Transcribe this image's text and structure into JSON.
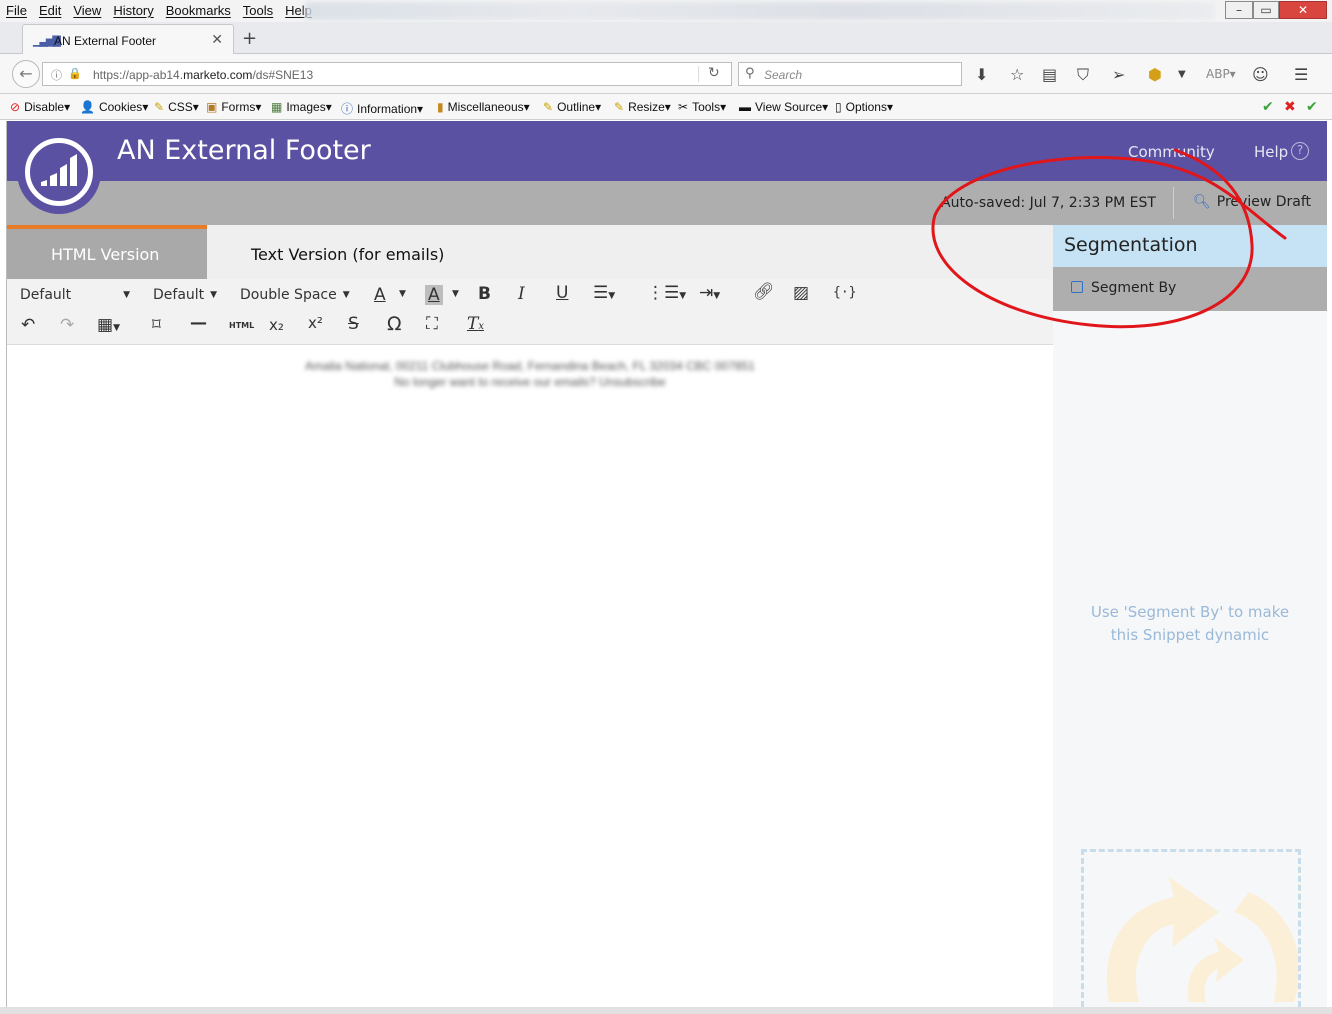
{
  "menubar": {
    "items": [
      "File",
      "Edit",
      "View",
      "History",
      "Bookmarks",
      "Tools",
      "Help"
    ]
  },
  "browser": {
    "tab_title": "AN External Footer",
    "url_prefix": "https://app-ab14.",
    "url_host": "marketo.com",
    "url_path": "/ds#SNE13",
    "search_placeholder": "Search"
  },
  "devbar": {
    "items": [
      "Disable",
      "Cookies",
      "CSS",
      "Forms",
      "Images",
      "Information",
      "Miscellaneous",
      "Outline",
      "Resize",
      "Tools",
      "View Source",
      "Options"
    ]
  },
  "app": {
    "title": "AN External Footer",
    "community": "Community",
    "help": "Help",
    "autosaved": "Auto-saved: Jul 7, 2:33 PM EST",
    "preview": "Preview Draft"
  },
  "editor": {
    "tab_html": "HTML Version",
    "tab_text": "Text Version (for emails)",
    "font_select": "Default",
    "size_select": "Default",
    "spacing_select": "Double Space",
    "blur_line1": "Amalia National, 00211 Clubhouse Road, Fernandina Beach, FL 32034 CBC 007851",
    "blur_line2": "No longer want to receive our emails? Unsubscribe"
  },
  "segmentation": {
    "title": "Segmentation",
    "segment_by": "Segment By",
    "hint_line1": "Use 'Segment By' to make",
    "hint_line2": "this Snippet dynamic"
  },
  "colors": {
    "header": "#5a51a2",
    "accent_orange": "#e77b28",
    "seg_header": "#c5e3f4",
    "annotation_red": "#e0161b"
  }
}
